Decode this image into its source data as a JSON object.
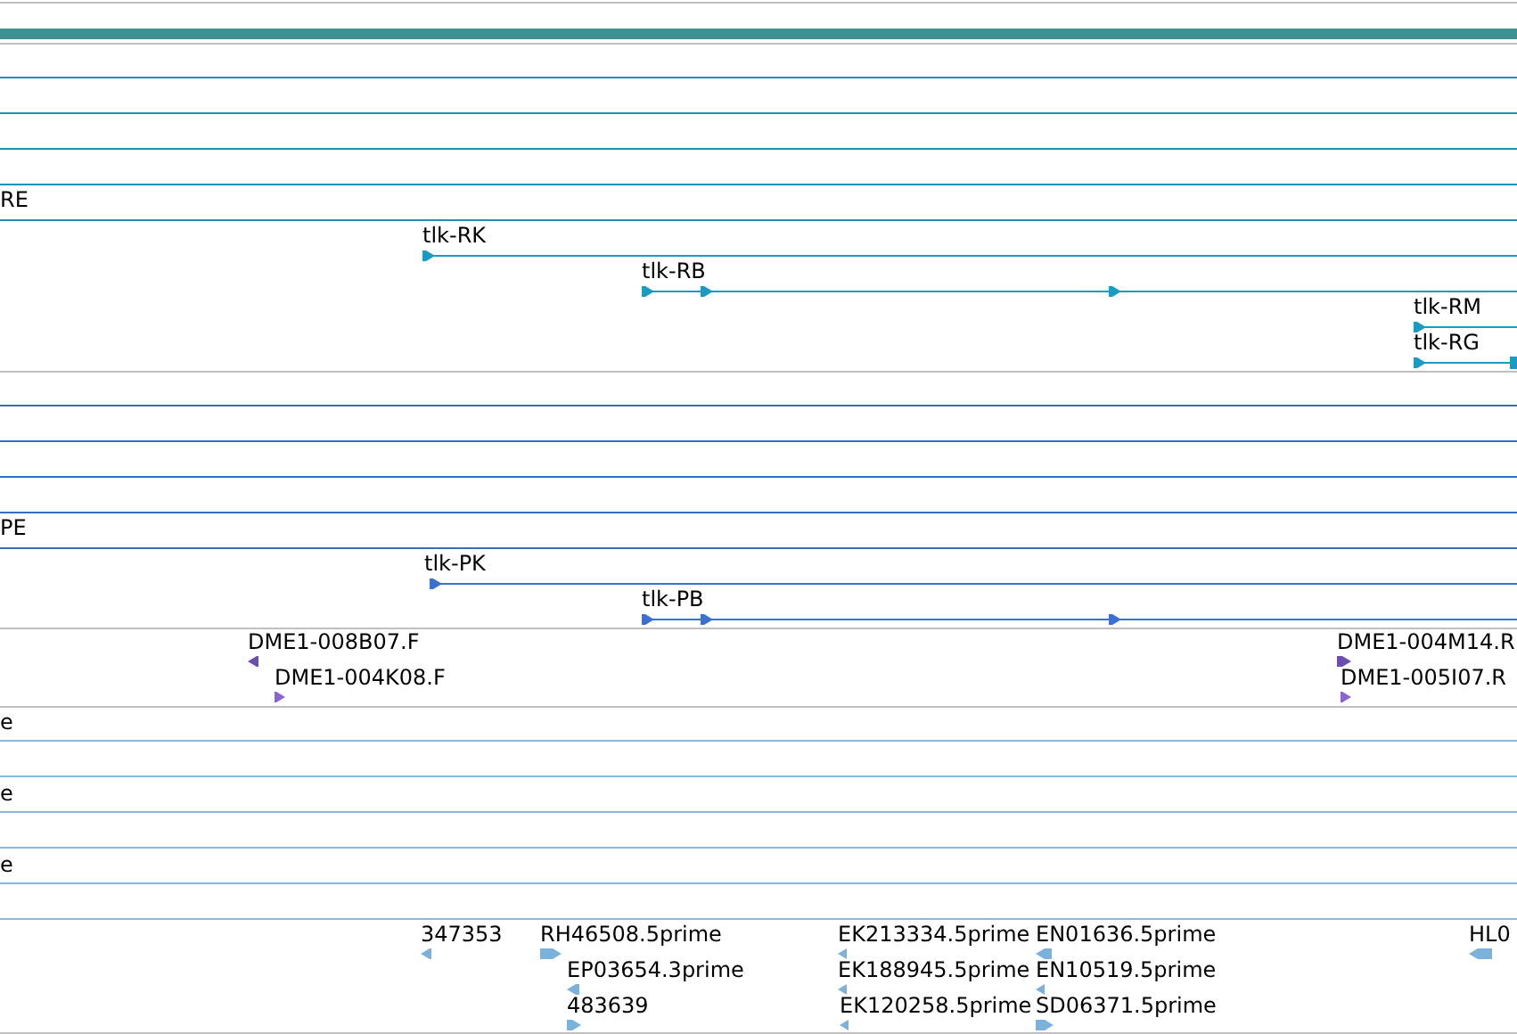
{
  "track_labels": [
    {
      "text": "RE"
    },
    {
      "text": "PE"
    },
    {
      "text": "e"
    },
    {
      "text": "e"
    },
    {
      "text": "e"
    }
  ],
  "transcripts": [
    {
      "name": "tlk-RK",
      "reverse": false
    },
    {
      "name": "tlk-RB",
      "reverse": false
    },
    {
      "name": "tlk-RM",
      "reverse": false
    },
    {
      "name": "tlk-RG",
      "reverse": false
    },
    {
      "name": "tlk-PK",
      "reverse": false
    },
    {
      "name": "tlk-PB",
      "reverse": false
    }
  ],
  "clones": [
    {
      "name": "DME1-008B07.F",
      "reverse": true
    },
    {
      "name": "DME1-004K08.F",
      "reverse": false
    },
    {
      "name": "DME1-004M14.R",
      "reverse": false
    },
    {
      "name": "DME1-005I07.R",
      "reverse": false
    }
  ],
  "ests": [
    {
      "name": "347353",
      "reverse": true
    },
    {
      "name": "RH46508.5prime",
      "reverse": false
    },
    {
      "name": "EP03654.3prime",
      "reverse": true
    },
    {
      "name": "483639",
      "reverse": false
    },
    {
      "name": "EK213334.5prime",
      "reverse": true
    },
    {
      "name": "EK188945.5prime",
      "reverse": true
    },
    {
      "name": "EK120258.5prime",
      "reverse": true
    },
    {
      "name": "EN01636.5prime",
      "reverse": true
    },
    {
      "name": "EN10519.5prime",
      "reverse": true
    },
    {
      "name": "SD06371.5prime",
      "reverse": false
    },
    {
      "name": "HL0",
      "reverse": true
    }
  ]
}
